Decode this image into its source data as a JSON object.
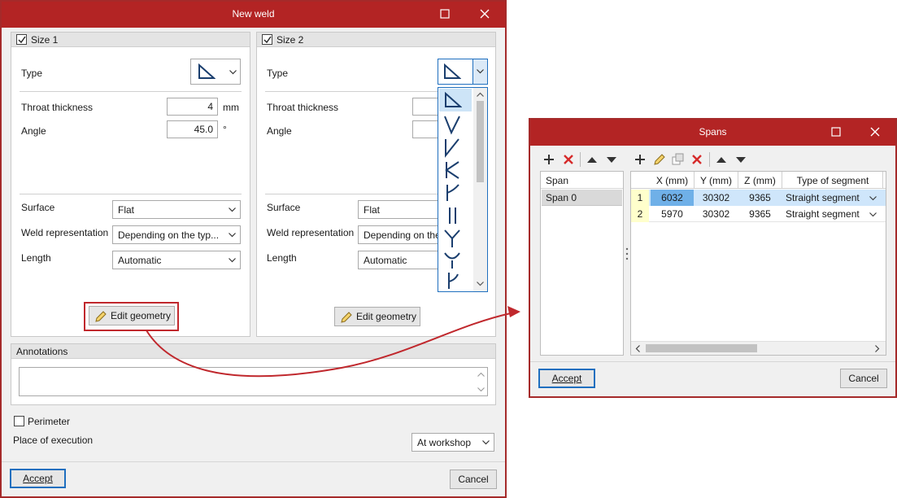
{
  "weld_dialog": {
    "title": "New weld",
    "size1": {
      "label": "Size 1",
      "type_label": "Type",
      "throat_label": "Throat thickness",
      "throat_value": "4",
      "throat_unit": "mm",
      "angle_label": "Angle",
      "angle_value": "45.0",
      "angle_unit": "°",
      "surface_label": "Surface",
      "surface_value": "Flat",
      "weld_rep_label": "Weld representation",
      "weld_rep_value": "Depending on the typ...",
      "length_label": "Length",
      "length_value": "Automatic",
      "edit_geometry": "Edit geometry"
    },
    "size2": {
      "label": "Size 2",
      "type_label": "Type",
      "throat_label": "Throat thickness",
      "angle_label": "Angle",
      "surface_label": "Surface",
      "surface_value": "Flat",
      "weld_rep_label": "Weld representation",
      "weld_rep_value": "Depending on the",
      "length_label": "Length",
      "length_value": "Automatic",
      "edit_geometry": "Edit geometry"
    },
    "annotations_label": "Annotations",
    "perimeter_label": "Perimeter",
    "place_label": "Place of execution",
    "place_value": "At workshop",
    "accept": "Accept",
    "cancel": "Cancel"
  },
  "spans_dialog": {
    "title": "Spans",
    "span_header": "Span",
    "span_items": [
      "Span 0"
    ],
    "columns": [
      "X (mm)",
      "Y (mm)",
      "Z (mm)",
      "Type of segment"
    ],
    "rows": [
      {
        "num": "1",
        "x": "6032",
        "y": "30302",
        "z": "9365",
        "type": "Straight segment"
      },
      {
        "num": "2",
        "x": "5970",
        "y": "30302",
        "z": "9365",
        "type": "Straight segment"
      }
    ],
    "accept": "Accept",
    "cancel": "Cancel"
  },
  "colors": {
    "title_bar": "#b32424",
    "selection": "#6fb0e8",
    "row_number_bg": "#ffffcc",
    "weld_symbol": "#1a3e6e"
  }
}
